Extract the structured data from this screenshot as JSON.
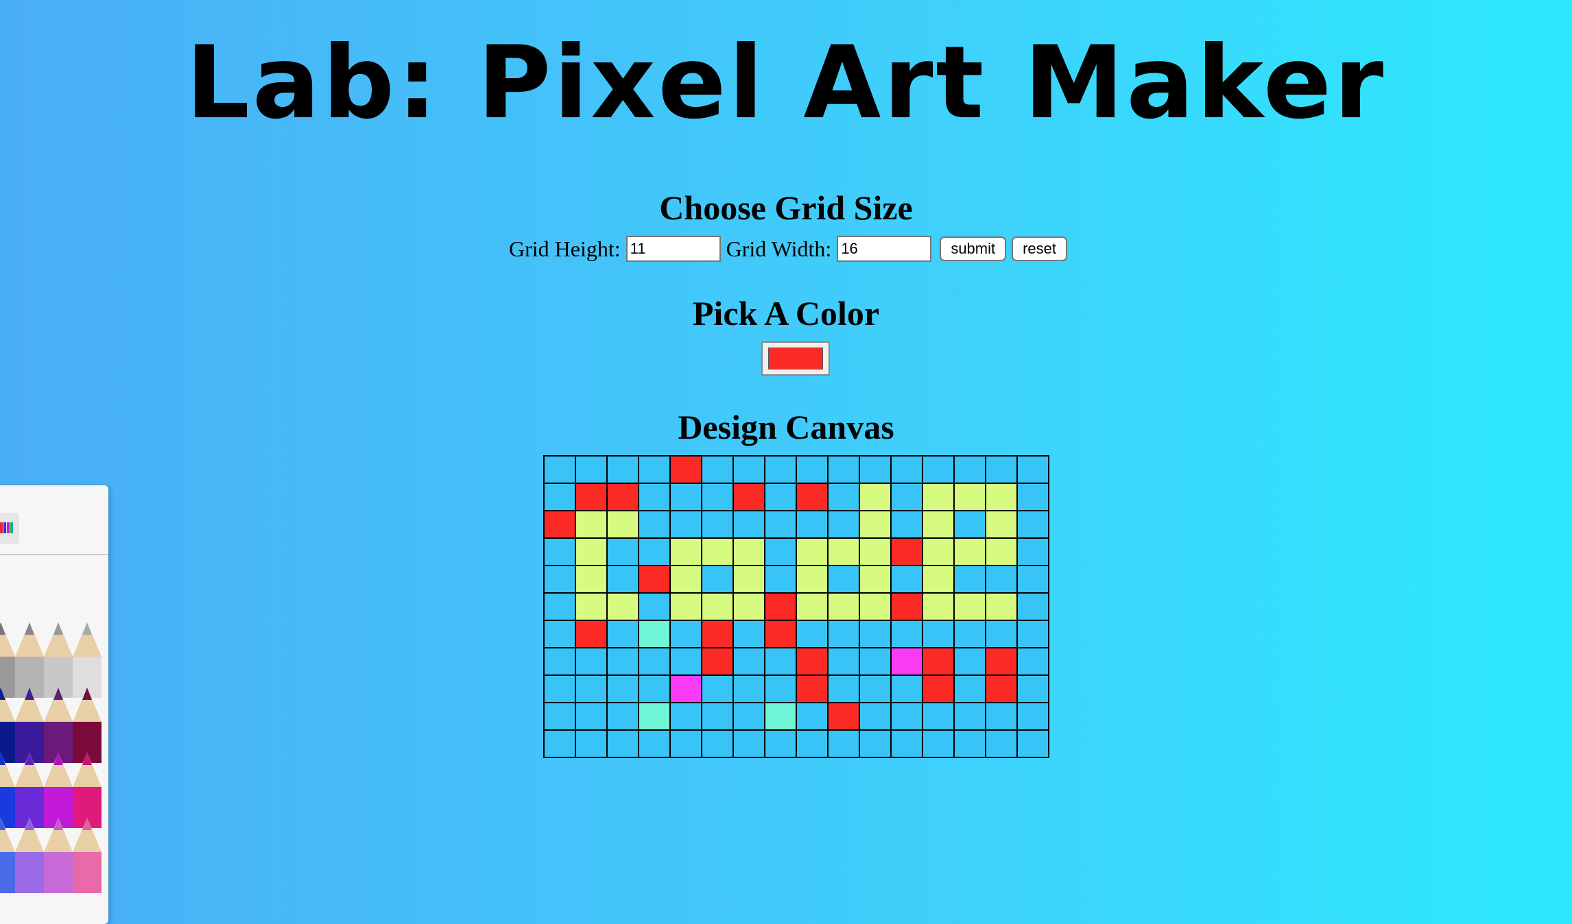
{
  "title": "Lab: Pixel Art Maker",
  "sections": {
    "grid_size_heading": "Choose Grid Size",
    "pick_color_heading": "Pick A Color",
    "canvas_heading": "Design Canvas"
  },
  "form": {
    "height_label": "Grid Height:",
    "height_value": "11",
    "width_label": "Grid Width:",
    "width_value": "16",
    "submit_label": "submit",
    "reset_label": "reset"
  },
  "color": {
    "selected": "#fb2a24"
  },
  "palette": {
    "B": "#38c4f6",
    "R": "#fb2a24",
    "Y": "#d6fb80",
    "M": "#fb3cf6",
    "T": "#70f6d6"
  },
  "grid": [
    "BBBBRBBBBBBBBBBB",
    "BRRBBBRBRBYBYYYB",
    "RYYBBBBBBBYBYBYB",
    "BYBBYYYBYYYRYYYB",
    "BYBRYBYBYBYBYBBB",
    "BYYBYYYRYYYRYYYB",
    "BRBTBRBRBBBBBBBB",
    "BBBBBRBBRBBMRBRB",
    "BBBBMBBBRBBBRBRB",
    "BBBTBBBTBRBBBBBB",
    "BBBBBBBBBBBBBBBB"
  ]
}
